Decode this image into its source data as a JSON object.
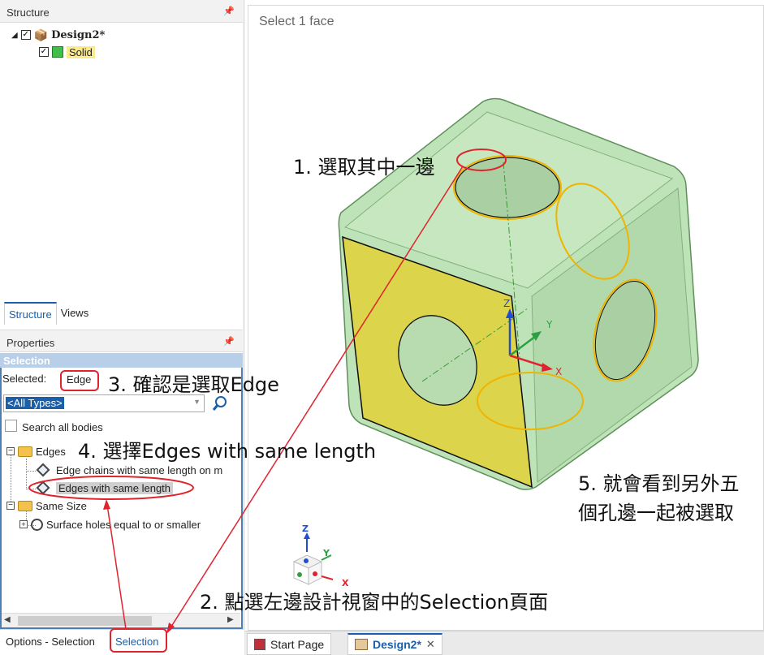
{
  "structure_panel": {
    "title": "Structure",
    "tree": {
      "root": "Design2*",
      "child": "Solid"
    },
    "tabs": [
      "Structure",
      "Views"
    ]
  },
  "properties_panel": {
    "title": "Properties"
  },
  "selection_panel": {
    "title": "Selection",
    "selected_label": "Selected:",
    "selected_value": "Edge",
    "type_dropdown": "<All Types>",
    "search_all_bodies": "Search all bodies",
    "tree": {
      "edges_group": "Edges",
      "edges_items": [
        "Edge chains with same length on m",
        "Edges with same length"
      ],
      "size_group": "Same Size",
      "size_items": [
        "Surface holes equal to or smaller"
      ]
    }
  },
  "bottom_tabs": {
    "options": "Options - Selection",
    "selection": "Selection"
  },
  "viewport": {
    "hint": "Select 1 face",
    "doc_tabs": [
      "Start Page",
      "Design2*"
    ],
    "triad": {
      "x": "X",
      "y": "Y",
      "z": "Z"
    }
  },
  "annotations": {
    "step1": "1. 選取其中一邊",
    "step2": "2. 點選左邊設計視窗中的Selection頁面",
    "step3": "3. 確認是選取Edge",
    "step4": "4. 選擇Edges with same length",
    "step5_line1": "5. 就會看到另外五",
    "step5_line2": "個孔邊一起被選取"
  },
  "colors": {
    "accent_blue": "#1a5fa8",
    "annotation_red": "#e0242f",
    "cube_green": "#bfe3b8",
    "face_yellow": "#dcd44a",
    "edge_highlight": "#f0b400"
  }
}
